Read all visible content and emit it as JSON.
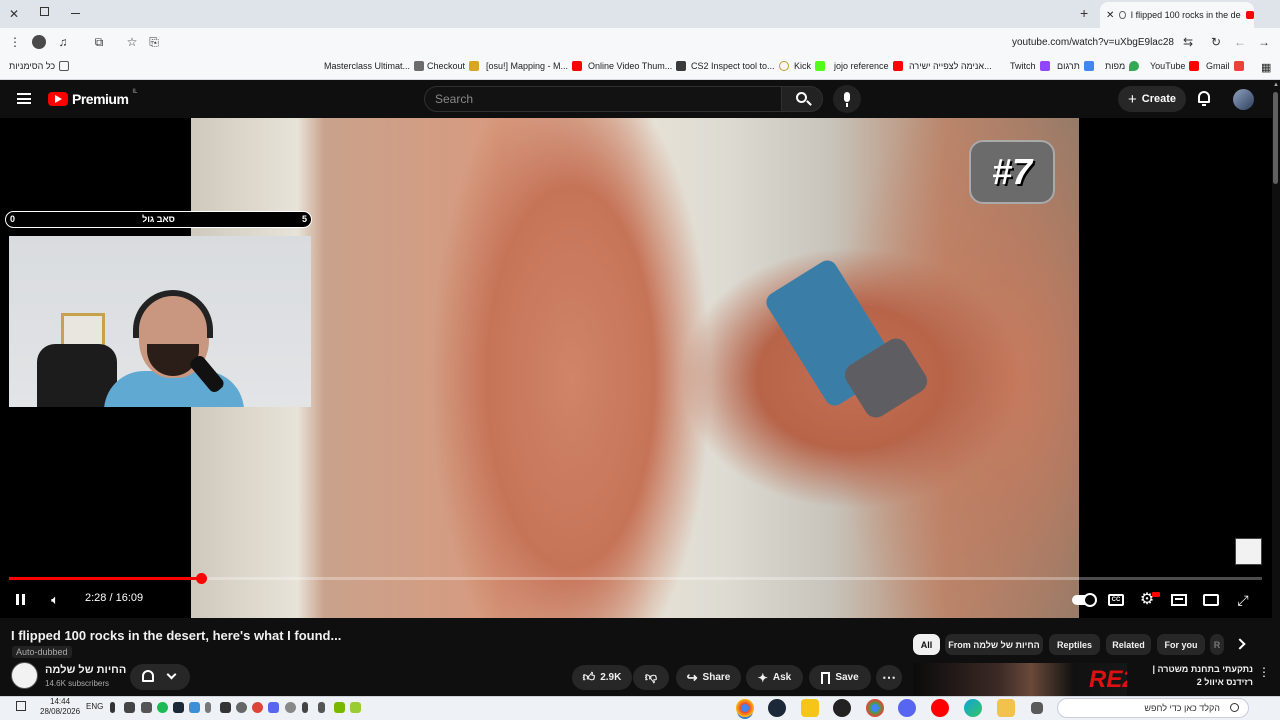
{
  "browser": {
    "tab_title": "I flipped 100 rocks in the de",
    "url": "youtube.com/watch?v=uXbgE9lac28",
    "bookmarks": [
      {
        "label": "כל הסימניות",
        "color": "#555555"
      },
      {
        "label": "Masterclass Ultimat...",
        "color": "#6b6b6b"
      },
      {
        "label": "Checkout",
        "color": "#d9a620"
      },
      {
        "label": "[osu!] Mapping - M...",
        "color": "#e0245e"
      },
      {
        "label": "Online Video Thum...",
        "color": "#3a3a3a"
      },
      {
        "label": "CS2 Inspect tool to...",
        "color": "#c79b2a"
      },
      {
        "label": "Kick",
        "color": "#53fc18"
      },
      {
        "label": "jojo reference",
        "color": "#ff0000"
      },
      {
        "label": "אנימה לצפייה ישירה...",
        "color": "#1b4db3"
      },
      {
        "label": "Twitch",
        "color": "#9146ff"
      },
      {
        "label": "תרגום",
        "color": "#4285f4"
      },
      {
        "label": "מפות",
        "color": "#34a853"
      },
      {
        "label": "YouTube",
        "color": "#ff0000"
      },
      {
        "label": "Gmail",
        "color": "#ea4335"
      }
    ]
  },
  "youtube": {
    "logo_label": "Premium",
    "logo_country": "IL",
    "search_placeholder": "Search",
    "create_label": "Create"
  },
  "player": {
    "badge": "#7",
    "counter_left": "0",
    "counter_label": "סאב גול",
    "counter_right": "5",
    "current_time": "2:28",
    "duration": "16:09",
    "time_display": "2:28 / 16:09",
    "progress_fraction": 0.153
  },
  "video": {
    "title": "I flipped 100 rocks in the desert, here's what I found...",
    "auto_dubbed": "Auto-dubbed",
    "channel_name": "החיות של שלמה",
    "subscribers": "14.6K subscribers",
    "likes": "2.9K",
    "share_label": "Share",
    "ask_label": "Ask",
    "save_label": "Save"
  },
  "chips": [
    "All",
    "From החיות של שלמה",
    "Reptiles",
    "Related",
    "For you",
    "R"
  ],
  "recommendation": {
    "title": "נתקעתי בתחנת משטרה | רזידנס איוול 2",
    "thumb_text": "RE2"
  },
  "taskbar": {
    "time": "14:44",
    "date": "28/08/2026",
    "lang": "ENG",
    "search_placeholder": "הקלד כאן כדי לחפש"
  },
  "colors": {
    "youtube_red": "#ff0000",
    "dark_bg": "#0f0f0f",
    "pill_bg": "#272727"
  }
}
